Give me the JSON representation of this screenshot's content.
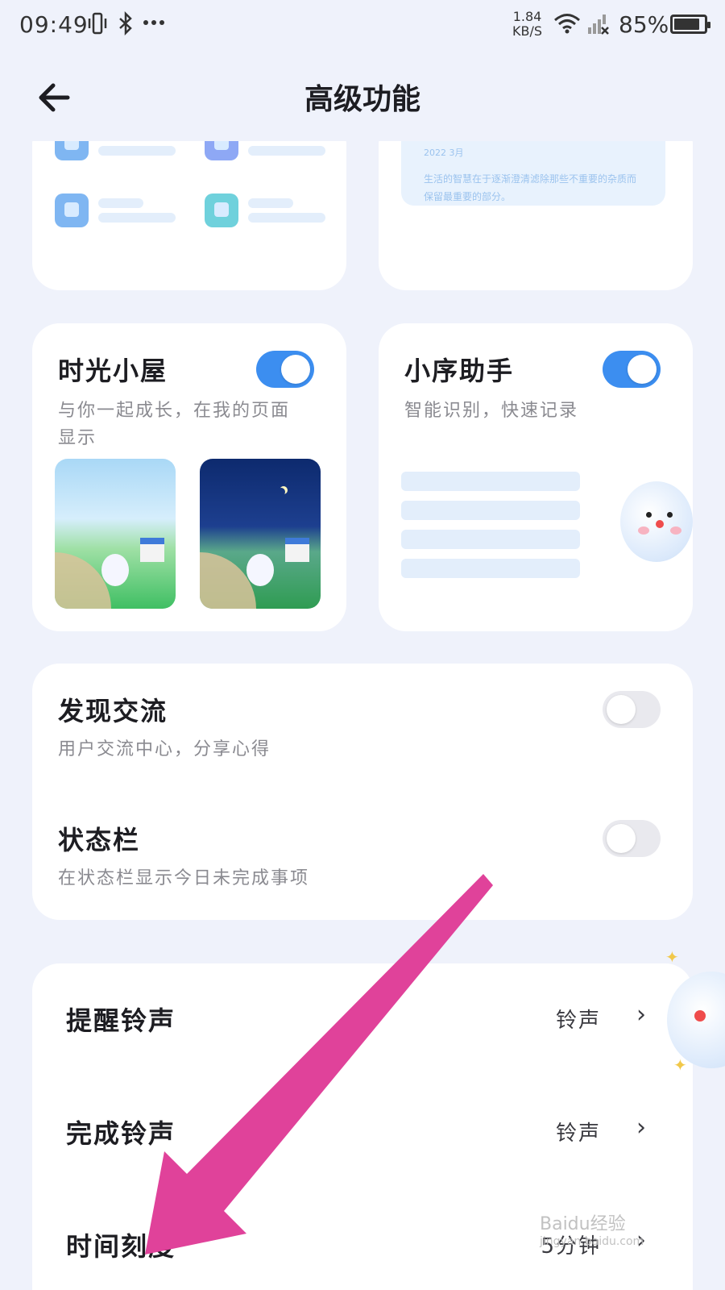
{
  "status_bar": {
    "time": "09:49",
    "net_speed_value": "1.84",
    "net_speed_unit": "KB/S",
    "battery": "85%",
    "battery_level": 0.85,
    "icons": [
      "vibrate-icon",
      "bluetooth-icon",
      "more-dots-icon",
      "wifi-icon",
      "signal-off-icon",
      "battery-icon"
    ]
  },
  "header": {
    "title": "高级功能",
    "back_icon": "back-arrow-icon"
  },
  "quote_card": {
    "date": "2022 3月",
    "text": "生活的智慧在于逐渐澄清滤除那些不重要的杂质而保留最重要的部分。"
  },
  "features": {
    "time_house": {
      "title": "时光小屋",
      "subtitle": "与你一起成长，在我的页面显示",
      "enabled": true
    },
    "helper": {
      "title": "小序助手",
      "subtitle": "智能识别，快速记录",
      "enabled": true
    },
    "discover": {
      "title": "发现交流",
      "subtitle": "用户交流中心，分享心得",
      "enabled": false
    },
    "status_bar": {
      "title": "状态栏",
      "subtitle": "在状态栏显示今日未完成事项",
      "enabled": false
    }
  },
  "settings": {
    "remind_sound": {
      "label": "提醒铃声",
      "value": "铃声"
    },
    "done_sound": {
      "label": "完成铃声",
      "value": "铃声"
    },
    "time_scale": {
      "label": "时间刻度",
      "value": "5分钟"
    }
  },
  "watermark": {
    "text": "Baidu经验",
    "url": "jingyan.baidu.com"
  },
  "colors": {
    "accent": "#3c8ef0",
    "background": "#eff2fb",
    "annotation_arrow": "#e0429a"
  }
}
